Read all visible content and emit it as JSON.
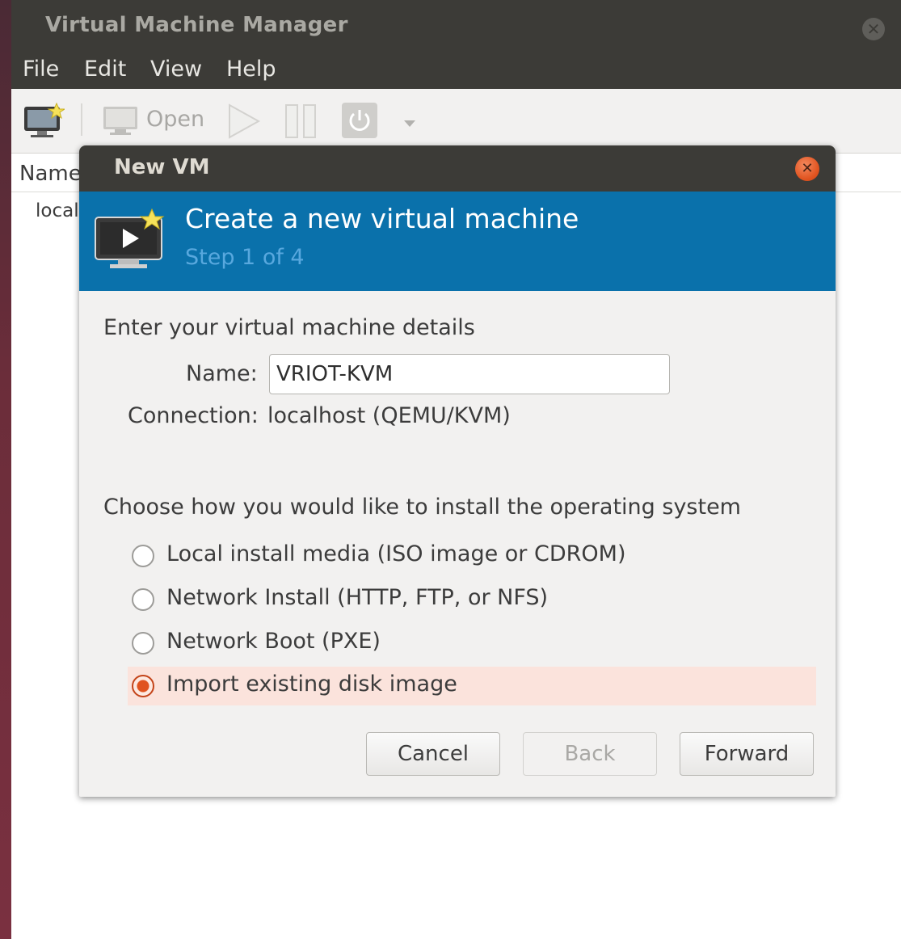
{
  "main_window": {
    "title": "Virtual Machine Manager",
    "menu": [
      "File",
      "Edit",
      "View",
      "Help"
    ],
    "toolbar": {
      "open_label": "Open"
    },
    "list": {
      "column_name": "Name",
      "rows": [
        "local"
      ]
    }
  },
  "dialog": {
    "title": "New VM",
    "banner": {
      "title": "Create a new virtual machine",
      "step": "Step 1 of 4"
    },
    "details_heading": "Enter your virtual machine details",
    "name_label": "Name:",
    "name_value": "VRIOT-KVM",
    "connection_label": "Connection:",
    "connection_value": "localhost (QEMU/KVM)",
    "install_heading": "Choose how you would like to install the operating system",
    "install_options": [
      {
        "label": "Local install media (ISO image or CDROM)",
        "selected": false
      },
      {
        "label": "Network Install (HTTP, FTP, or NFS)",
        "selected": false
      },
      {
        "label": "Network Boot (PXE)",
        "selected": false
      },
      {
        "label": "Import existing disk image",
        "selected": true
      }
    ],
    "buttons": {
      "cancel": "Cancel",
      "back": "Back",
      "forward": "Forward"
    }
  },
  "colors": {
    "titlebar": "#3c3b37",
    "banner": "#0a71ab",
    "accent": "#e0531f",
    "selected_row": "#fbe3dc"
  }
}
